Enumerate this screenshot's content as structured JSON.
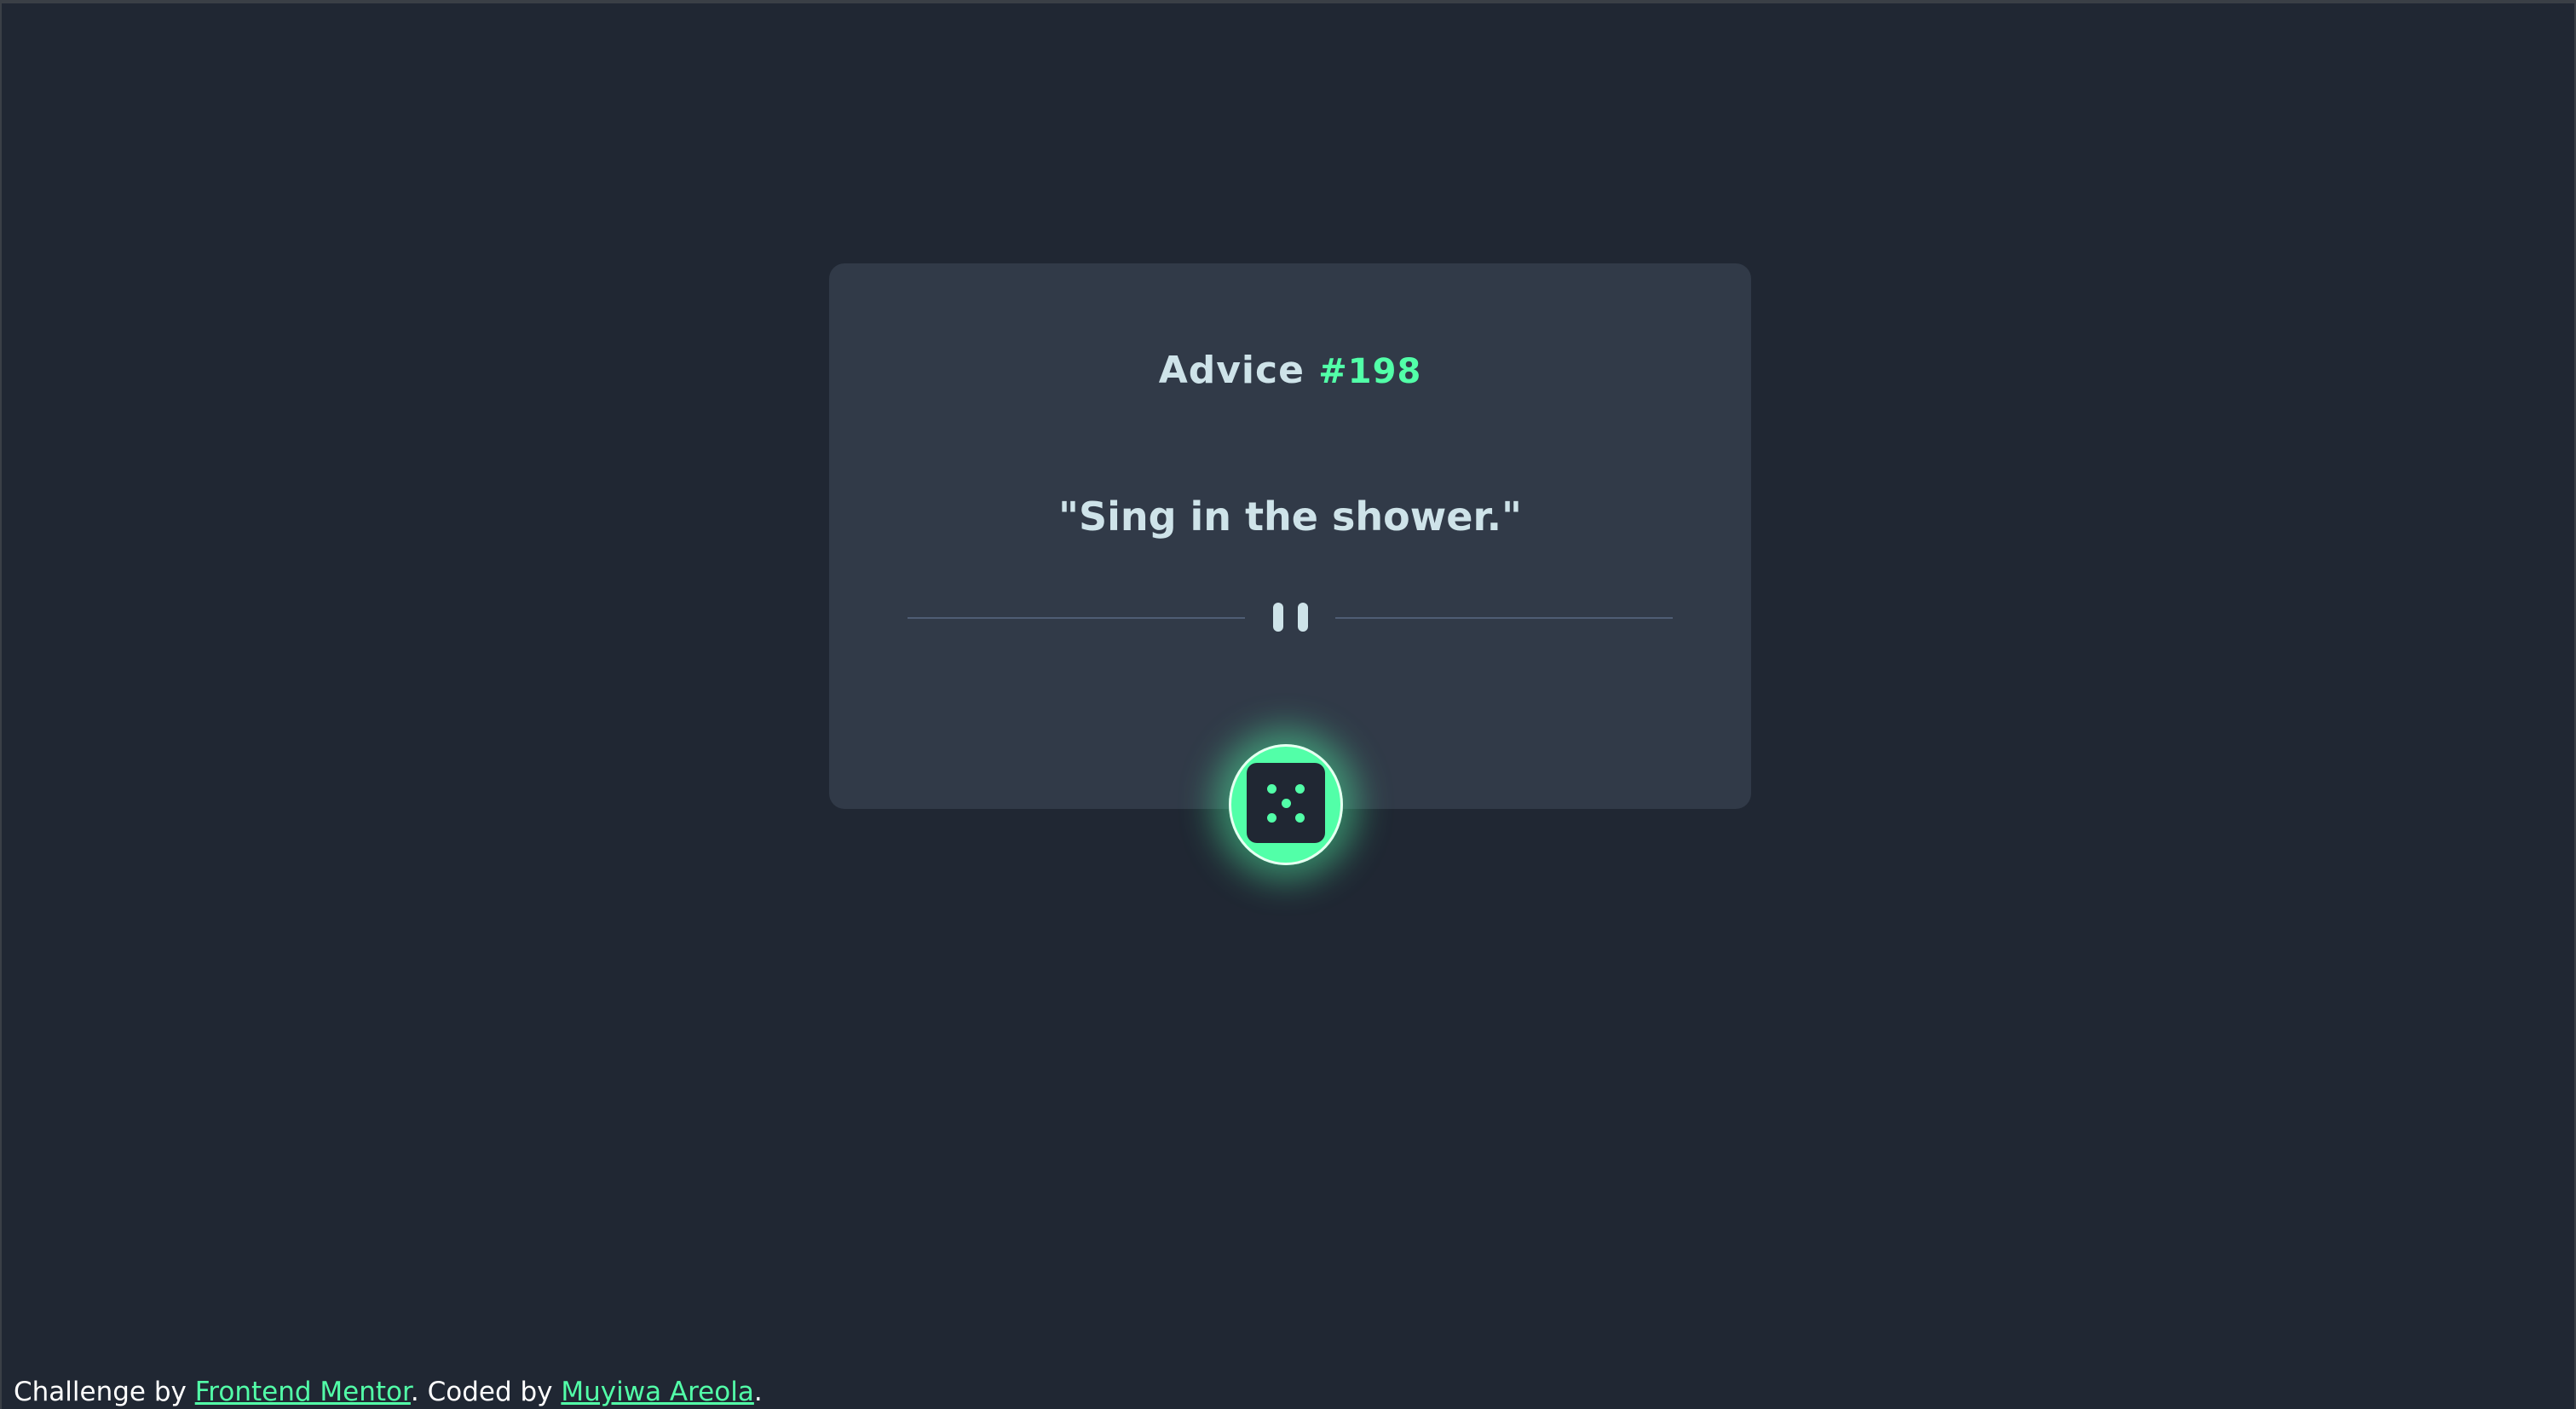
{
  "card": {
    "title_label": "Advice",
    "advice_number": "#198",
    "quote": "\"Sing in the shower.\""
  },
  "dice_button": {
    "icon": "dice-icon"
  },
  "divider": {
    "icon": "pause-icon"
  },
  "footer": {
    "prefix": "Challenge by ",
    "challenge_link": "Frontend Mentor",
    "middle": ". Coded by ",
    "author_link": "Muyiwa Areola",
    "suffix": "."
  },
  "colors": {
    "background": "#202733",
    "card": "#313a48",
    "accent": "#52ffa8",
    "text": "#cee3e9"
  }
}
